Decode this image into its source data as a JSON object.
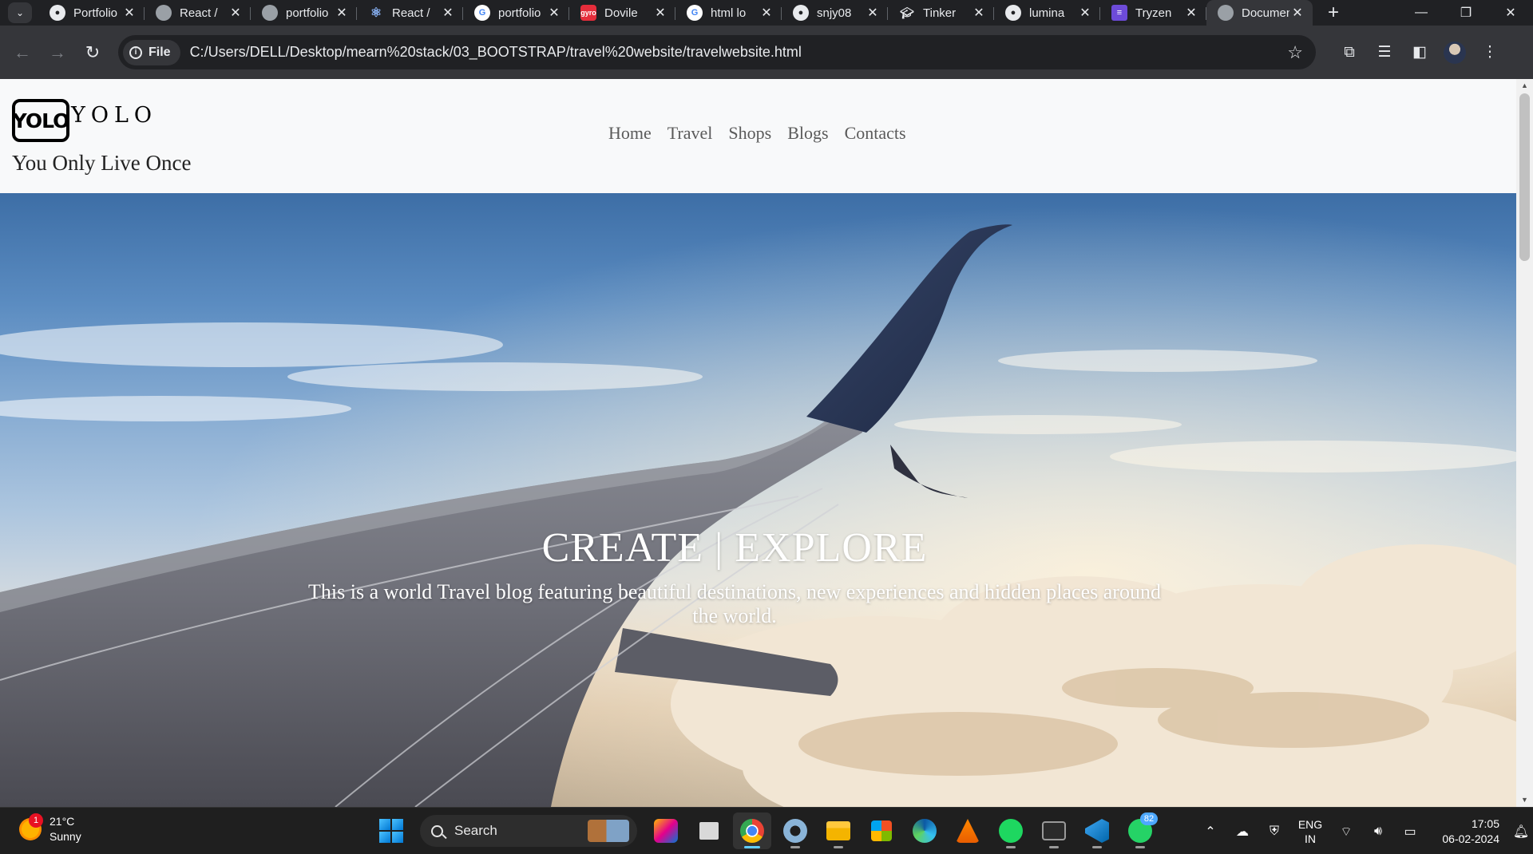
{
  "browser": {
    "tabs": [
      {
        "title": "Portfolio",
        "icon": "github-icon"
      },
      {
        "title": "React /",
        "icon": "globe-icon"
      },
      {
        "title": "portfolio",
        "icon": "globe-icon"
      },
      {
        "title": "React /",
        "icon": "react-icon"
      },
      {
        "title": "portfolio",
        "icon": "google-icon"
      },
      {
        "title": "Dovile",
        "icon": "dovile-icon",
        "icon_text": "gyro"
      },
      {
        "title": "html lo",
        "icon": "google-icon"
      },
      {
        "title": "snjy08",
        "icon": "github-icon"
      },
      {
        "title": "Tinker",
        "icon": "tinker-icon"
      },
      {
        "title": "lumina",
        "icon": "github-icon"
      },
      {
        "title": "Tryzen",
        "icon": "tryzen-icon"
      },
      {
        "title": "Document",
        "icon": "globe-icon",
        "active": true
      }
    ],
    "address": {
      "scheme_chip": "File",
      "url": "C:/Users/DELL/Desktop/mearn%20stack/03_BOOTSTRAP/travel%20website/travelwebsite.html"
    }
  },
  "site": {
    "logo_text": "YOLO",
    "brand_name": "YOLO",
    "tagline": "You Only Live Once",
    "nav": [
      "Home",
      "Travel",
      "Shops",
      "Blogs",
      "Contacts"
    ],
    "hero": {
      "title": "CREATE | EXPLORE",
      "subtitle": "This is a world Travel blog featuring beautiful destinations, new experiences and hidden places around the world."
    }
  },
  "taskbar": {
    "weather": {
      "temp": "21°C",
      "condition": "Sunny",
      "badge": "1"
    },
    "search_label": "Search",
    "whatsapp_badge": "82",
    "language": {
      "line1": "ENG",
      "line2": "IN"
    },
    "clock": {
      "time": "17:05",
      "date": "06-02-2024"
    }
  },
  "colors": {
    "browser_frame": "#202124",
    "toolbar": "#35363a",
    "page_bg": "#f8f9fa",
    "taskbar": "#1f1f1f",
    "accent_blue": "#60cdff"
  }
}
